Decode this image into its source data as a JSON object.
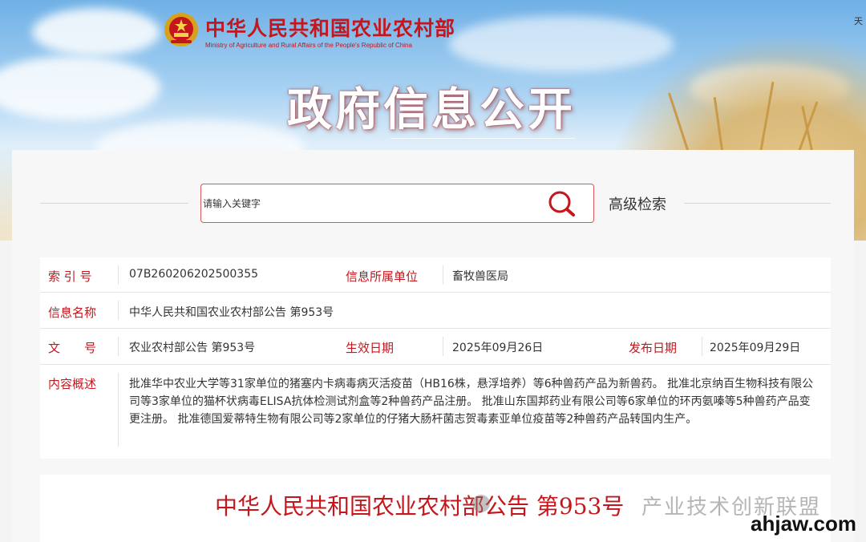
{
  "header": {
    "ministry_cn": "中华人民共和国农业农村部",
    "ministry_en": "Ministry of Agriculture and Rural Affairs of the People's Republic of China",
    "top_right_text": "天",
    "page_title": "政府信息公开"
  },
  "search": {
    "placeholder": "请输入关键字",
    "icon": "search-icon",
    "advanced_label": "高级检索"
  },
  "info": {
    "index_label": "索 引 号",
    "index_value": "07B260206202500355",
    "dept_label": "信息所属单位",
    "dept_value": "畜牧兽医局",
    "name_label": "信息名称",
    "name_value": "中华人民共和国农业农村部公告 第953号",
    "doc_label": "文　　号",
    "doc_value": "农业农村部公告 第953号",
    "effective_label": "生效日期",
    "effective_value": "2025年09月26日",
    "publish_label": "发布日期",
    "publish_value": "2025年09月29日",
    "summary_label": "内容概述",
    "summary_value": "批准华中农业大学等31家单位的猪塞内卡病毒病灭活疫苗（HB16株，悬浮培养）等6种兽药产品为新兽药。 批准北京纳百生物科技有限公司等3家单位的猫杯状病毒ELISA抗体检测试剂盒等2种兽药产品注册。 批准山东国邦药业有限公司等6家单位的环丙氨嗪等5种兽药产品变更注册。 批准德国爱蒂特生物有限公司等2家单位的仔猪大肠杆菌志贺毒素亚单位疫苗等2种兽药产品转国内生产。"
  },
  "article": {
    "title": "中华人民共和国农业农村部公告 第953号"
  },
  "watermark": {
    "text": "产业技术创新联盟",
    "site": "ahjaw.com"
  },
  "colors": {
    "accent_red": "#c4161c",
    "search_border": "#d9565b"
  }
}
